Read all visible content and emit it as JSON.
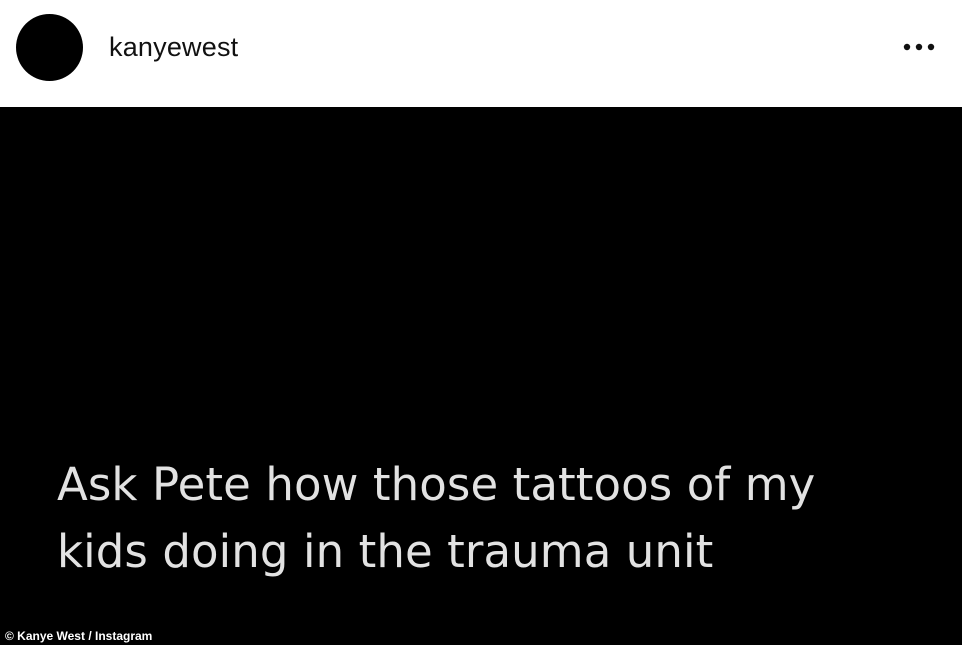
{
  "post": {
    "username": "kanyewest",
    "more_icon": "more-horizontal-icon",
    "caption_lines": [
      "Ask Pete how those tattoos of my",
      "kids doing in the trauma unit"
    ]
  },
  "credit": "© Kanye West / Instagram",
  "colors": {
    "header_bg": "#ffffff",
    "post_bg": "#000000",
    "caption_text": "#e2e2e2",
    "avatar": "#000000"
  }
}
